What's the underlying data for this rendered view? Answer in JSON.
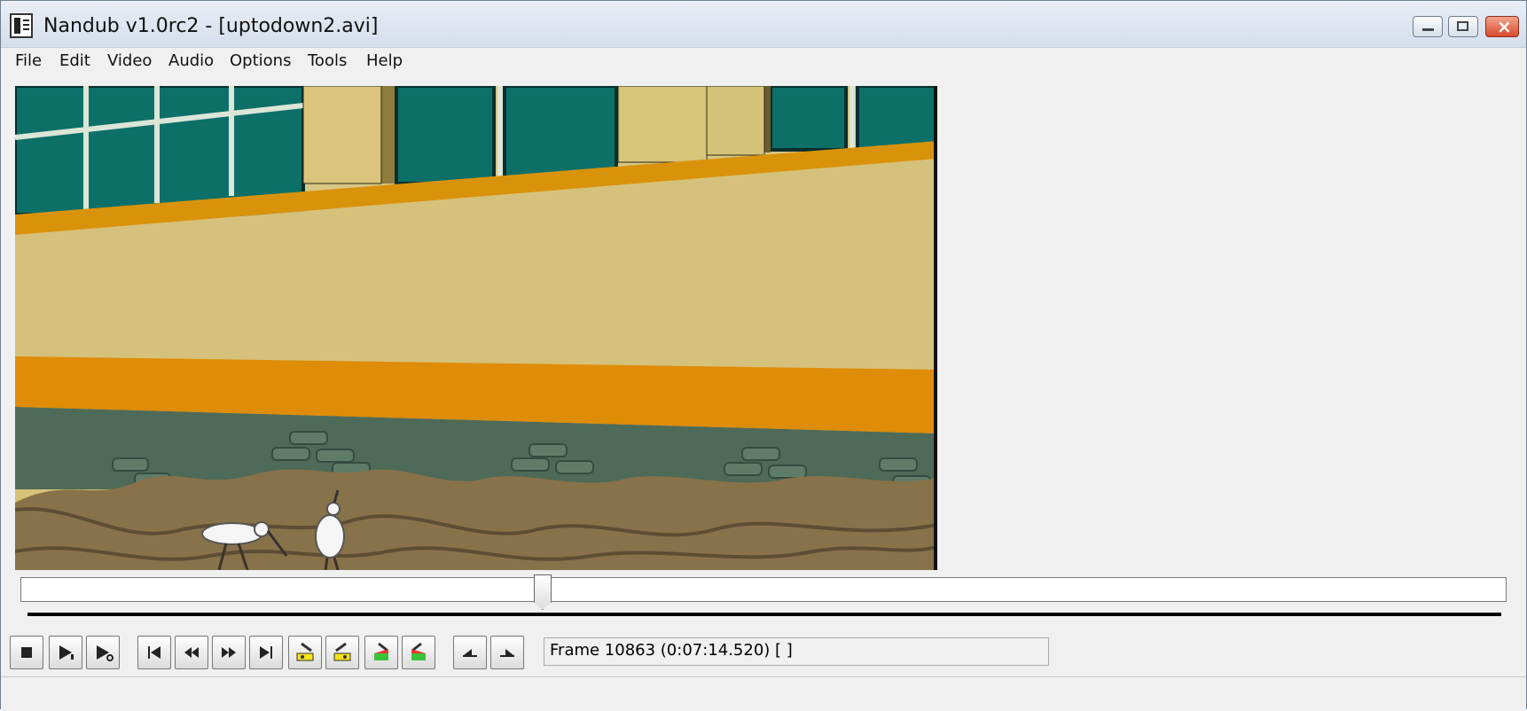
{
  "window": {
    "title": "Nandub v1.0rc2 - [uptodown2.avi]"
  },
  "menu": {
    "items": [
      "File",
      "Edit",
      "Video",
      "Audio",
      "Options",
      "Tools",
      "Help"
    ]
  },
  "toolbar": {
    "icons": [
      "stop-icon",
      "play-input-icon",
      "play-output-icon",
      "start-icon",
      "prev-frame-icon",
      "next-frame-icon",
      "end-icon",
      "prev-keyframe-icon",
      "next-keyframe-icon",
      "prev-scene-icon",
      "next-scene-icon",
      "mark-in-icon",
      "mark-out-icon"
    ]
  },
  "status": {
    "frame_text": "Frame 10863 (0:07:14.520) [ ]"
  },
  "seek": {
    "position": 0.35
  }
}
